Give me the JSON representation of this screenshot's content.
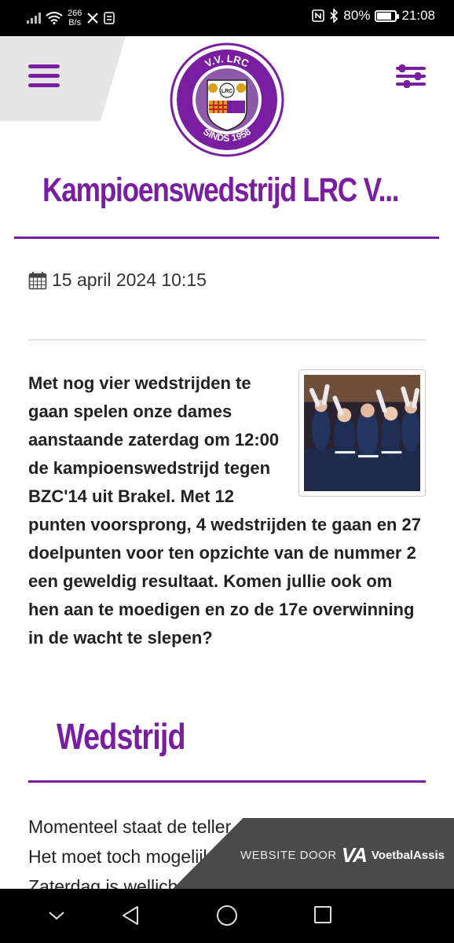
{
  "status_bar": {
    "speed_value": "266",
    "speed_unit": "B/s",
    "battery": "80%",
    "battery_level": 0.8,
    "time": "21:08"
  },
  "header": {
    "logo": {
      "top_text": "V.V. LRC",
      "badge_text": "LRC",
      "bottom_text": "SINDS 1958"
    }
  },
  "article": {
    "title": "Kampioenswedstrijd LRC V...",
    "date": "15 april 2024 10:15",
    "body": "Met nog vier wedstrijden te gaan spelen onze dames aanstaande zaterdag om 12:00 de kampioenswedstrijd tegen BZC'14 uit Brakel. Met 12 punten voorsprong, 4 wedstrijden te gaan en 27 doelpunten voor ten opzichte van de nummer 2 een geweldig resultaat. Komen jullie ook om hen aan te moedigen en zo de 17e overwinning in de wacht te slepen?"
  },
  "section": {
    "title": "Wedstrijd",
    "lines": [
      "Momenteel staat de teller",
      "Het moet toch mogelijk",
      "Zaterdag is wellich"
    ]
  },
  "credit": {
    "by": "WEBSITE DOOR",
    "va": "VA",
    "name": "VoetbalAssis"
  },
  "colors": {
    "brand_purple": "#7a1ea1",
    "credit_background": "#4a4a4a"
  },
  "icons": [
    "signal-icon",
    "wifi-icon",
    "x-icon",
    "nfc-icon",
    "bluetooth-icon",
    "battery-icon",
    "hamburger-menu-icon",
    "filter-sliders-icon",
    "calendar-icon",
    "back-icon",
    "home-icon",
    "recents-icon",
    "collapse-icon"
  ]
}
